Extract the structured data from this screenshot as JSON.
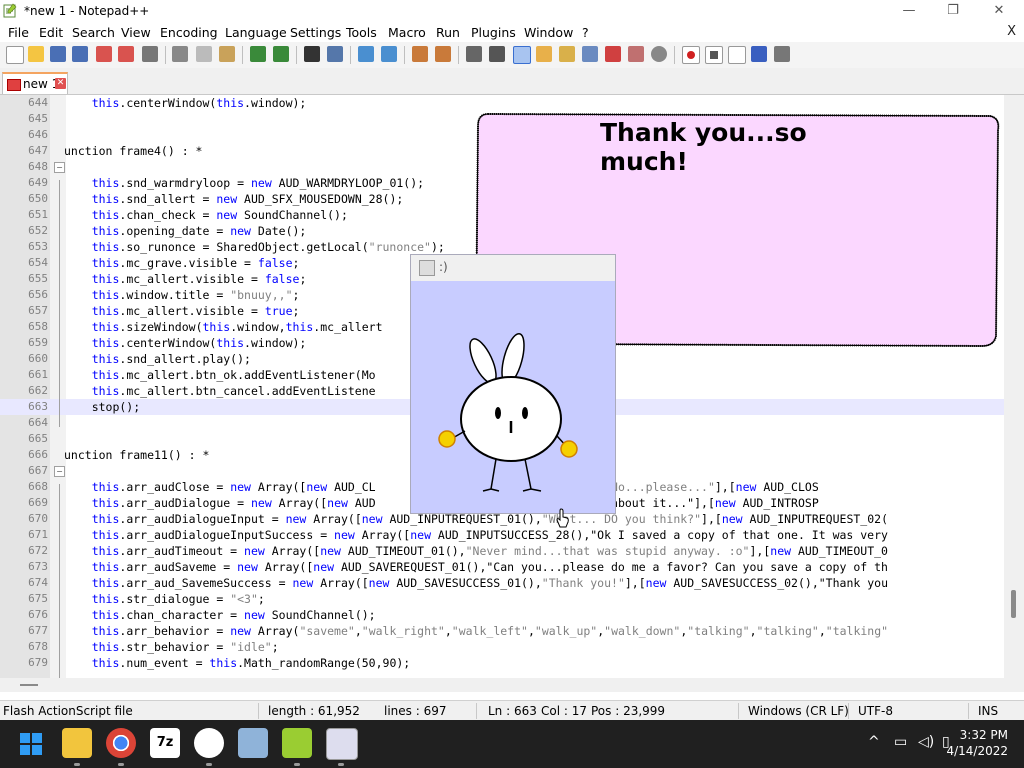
{
  "window": {
    "title": "*new 1 - Notepad++",
    "minimize": "—",
    "maximize": "❐",
    "close": "✕"
  },
  "menu": {
    "items": [
      "File",
      "Edit",
      "Search",
      "View",
      "Encoding",
      "Language",
      "Settings",
      "Tools",
      "Macro",
      "Run",
      "Plugins",
      "Window",
      "?"
    ],
    "close": "X"
  },
  "tabs": [
    {
      "label": "new 1",
      "close": "✕"
    }
  ],
  "editor": {
    "lines": [
      {
        "n": "644",
        "code": "    this.centerWindow(this.window);"
      },
      {
        "n": "645",
        "code": ""
      },
      {
        "n": "646",
        "code": ""
      },
      {
        "n": "647",
        "code": "unction frame4() : *"
      },
      {
        "n": "648",
        "code": ""
      },
      {
        "n": "649",
        "code": "    this.snd_warmdryloop = new AUD_WARMDRYLOOP_01();"
      },
      {
        "n": "650",
        "code": "    this.snd_allert = new AUD_SFX_MOUSEDOWN_28();"
      },
      {
        "n": "651",
        "code": "    this.chan_check = new SoundChannel();"
      },
      {
        "n": "652",
        "code": "    this.opening_date = new Date();"
      },
      {
        "n": "653",
        "code": "    this.so_runonce = SharedObject.getLocal(\"runonce\");"
      },
      {
        "n": "654",
        "code": "    this.mc_grave.visible = false;"
      },
      {
        "n": "655",
        "code": "    this.mc_allert.visible = false;"
      },
      {
        "n": "656",
        "code": "    this.window.title = \"bnuuy,,\";"
      },
      {
        "n": "657",
        "code": "    this.mc_allert.visible = true;"
      },
      {
        "n": "658",
        "code": "    this.sizeWindow(this.window,this.mc_allert"
      },
      {
        "n": "659",
        "code": "    this.centerWindow(this.window);"
      },
      {
        "n": "660",
        "code": "    this.snd_allert.play();"
      },
      {
        "n": "661",
        "code": "    this.mc_allert.btn_ok.addEventListener(Mo                ent_check_ok);"
      },
      {
        "n": "662",
        "code": "    this.mc_allert.btn_cancel.addEventListene               s.event_check_no);"
      },
      {
        "n": "663",
        "code": "    stop();"
      },
      {
        "n": "664",
        "code": ""
      },
      {
        "n": "665",
        "code": ""
      },
      {
        "n": "666",
        "code": "unction frame11() : *"
      },
      {
        "n": "667",
        "code": ""
      },
      {
        "n": "668",
        "code": "    this.arr_audClose = new Array([new AUD_CL               ew AUD_CLOSE_02(),\"No...please...\"],[new AUD_CLOS"
      },
      {
        "n": "669",
        "code": "    this.arr_audDialogue = new Array([new AUD               an... If you think about it...\"],[new AUD_INTROSP"
      },
      {
        "n": "670",
        "code": "    this.arr_audDialogueInput = new Array([new AUD_INPUTREQUEST_01(),\"What... DO you think?\"],[new AUD_INPUTREQUEST_02("
      },
      {
        "n": "671",
        "code": "    this.arr_audDialogueInputSuccess = new Array([new AUD_INPUTSUCCESS_28(),\"Ok I saved a copy of that one. It was very"
      },
      {
        "n": "672",
        "code": "    this.arr_audTimeout = new Array([new AUD_TIMEOUT_01(),\"Never mind...that was stupid anyway. :o\"],[new AUD_TIMEOUT_0"
      },
      {
        "n": "673",
        "code": "    this.arr_audSaveme = new Array([new AUD_SAVEREQUEST_01(),\"Can you...please do me a favor? Can you save a copy of th"
      },
      {
        "n": "674",
        "code": "    this.arr_aud_SavemeSuccess = new Array([new AUD_SAVESUCCESS_01(),\"Thank you!\"],[new AUD_SAVESUCCESS_02(),\"Thank you"
      },
      {
        "n": "675",
        "code": "    this.str_dialogue = \"<3\";"
      },
      {
        "n": "676",
        "code": "    this.chan_character = new SoundChannel();"
      },
      {
        "n": "677",
        "code": "    this.arr_behavior = new Array(\"saveme\",\"walk_right\",\"walk_left\",\"walk_up\",\"walk_down\",\"talking\",\"talking\",\"talking\""
      },
      {
        "n": "678",
        "code": "    this.str_behavior = \"idle\";"
      },
      {
        "n": "679",
        "code": "    this.num_event = this.Math_randomRange(50,90);"
      }
    ],
    "current_line": "663"
  },
  "status": {
    "file_type": "Flash ActionScript file",
    "length": "length : 61,952",
    "lines": "lines : 697",
    "ln": "Ln : 663",
    "col": "Col : 17",
    "pos": "Pos : 23,999",
    "eol": "Windows (CR LF)",
    "encoding": "UTF-8",
    "mode": "INS"
  },
  "popup": {
    "title": ":)"
  },
  "bubble": {
    "text": "Thank you...so much!"
  },
  "taskbar": {
    "apps": [
      "start-icon",
      "file-explorer-icon",
      "chrome-icon",
      "7zip-icon",
      "flashdevelop-icon",
      "photos-icon",
      "notepadpp-icon",
      "bunny-app-icon"
    ],
    "time": "3:32 PM",
    "date": "4/14/2022"
  },
  "colors": {
    "bubble_fill": "#fbd7ff",
    "popup_bg": "#c8ccff",
    "keyword": "#0000ff",
    "string": "#808080",
    "taskbar": "#202020"
  }
}
